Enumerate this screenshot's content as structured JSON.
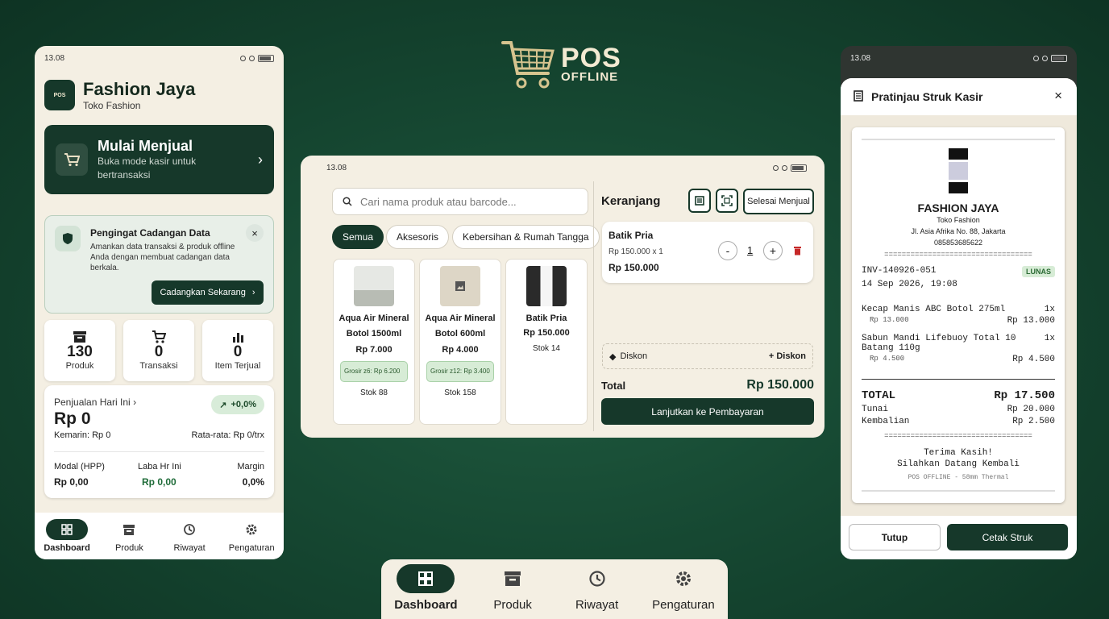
{
  "logo": {
    "line1": "POS",
    "line2": "OFFLINE"
  },
  "status": {
    "time": "13.08"
  },
  "dashboard": {
    "app_logo_text": "POS",
    "title": "Fashion Jaya",
    "subtitle": "Toko Fashion",
    "sell": {
      "title": "Mulai Menjual",
      "desc": "Buka mode kasir untuk bertransaksi"
    },
    "backup": {
      "title": "Pengingat Cadangan Data",
      "desc": "Amankan data transaksi & produk offline Anda dengan membuat cadangan data berkala.",
      "button": "Cadangkan Sekarang"
    },
    "stats": [
      {
        "value": "130",
        "label": "Produk"
      },
      {
        "value": "0",
        "label": "Transaksi"
      },
      {
        "value": "0",
        "label": "Item Terjual"
      }
    ],
    "sales": {
      "label": "Penjualan Hari Ini",
      "value": "Rp 0",
      "badge": "+0,0%",
      "yesterday": "Kemarin: Rp 0",
      "average": "Rata-rata: Rp 0/trx",
      "cols": [
        {
          "label": "Modal (HPP)",
          "value": "Rp 0,00"
        },
        {
          "label": "Laba Hr Ini",
          "value": "Rp 0,00"
        },
        {
          "label": "Margin",
          "value": "0,0%"
        }
      ]
    },
    "nav": [
      "Dashboard",
      "Produk",
      "Riwayat",
      "Pengaturan"
    ]
  },
  "pos": {
    "search_placeholder": "Cari nama produk atau barcode...",
    "chips": [
      "Semua",
      "Aksesoris",
      "Kebersihan & Rumah Tangga"
    ],
    "products": [
      {
        "name": "Aqua Air Mineral Botol 1500ml",
        "price": "Rp 7.000",
        "grosir": "Grosir z6: Rp 6.200",
        "stock": "Stok 88"
      },
      {
        "name": "Aqua Air Mineral Botol 600ml",
        "price": "Rp 4.000",
        "grosir": "Grosir z12: Rp 3.400",
        "stock": "Stok 158"
      },
      {
        "name": "Batik Pria",
        "price": "Rp 150.000",
        "grosir": "",
        "stock": "Stok 14"
      }
    ],
    "cart_title": "Keranjang",
    "finish_button": "Selesai Menjual",
    "cart_item": {
      "name": "Batik Pria",
      "detail": "Rp 150.000 x 1",
      "subtotal": "Rp 150.000",
      "qty": "1",
      "minus": "-",
      "plus": "+"
    },
    "discount_label": "Diskon",
    "discount_add": "+ Diskon",
    "total_label": "Total",
    "total_value": "Rp 150.000",
    "pay_button": "Lanjutkan ke Pembayaran"
  },
  "receipt": {
    "title": "Pratinjau Struk Kasir",
    "store": "FASHION JAYA",
    "store_type": "Toko Fashion",
    "address": "Jl. Asia Afrika No. 88, Jakarta",
    "phone": "085853685622",
    "divider": "==================================",
    "invoice": "INV-140926-051",
    "status": "LUNAS",
    "date": "14 Sep 2026, 19:08",
    "items": [
      {
        "name": "Kecap Manis ABC Botol 275ml",
        "qty": "1x",
        "unit": "Rp 13.000",
        "total": "Rp 13.000"
      },
      {
        "name": "Sabun Mandi Lifebuoy Total 10 Batang 110g",
        "qty": "1x",
        "unit": "Rp 4.500",
        "total": "Rp 4.500"
      }
    ],
    "total_label": "TOTAL",
    "total": "Rp 17.500",
    "cash_label": "Tunai",
    "cash": "Rp 20.000",
    "change_label": "Kembalian",
    "change": "Rp 2.500",
    "thanks": "Terima Kasih!",
    "come_again": "Silahkan Datang Kembali",
    "footer": "POS OFFLINE - 58mm Thermal",
    "close_button": "Tutup",
    "print_button": "Cetak Struk"
  },
  "bottom_nav": [
    "Dashboard",
    "Produk",
    "Riwayat",
    "Pengaturan"
  ]
}
